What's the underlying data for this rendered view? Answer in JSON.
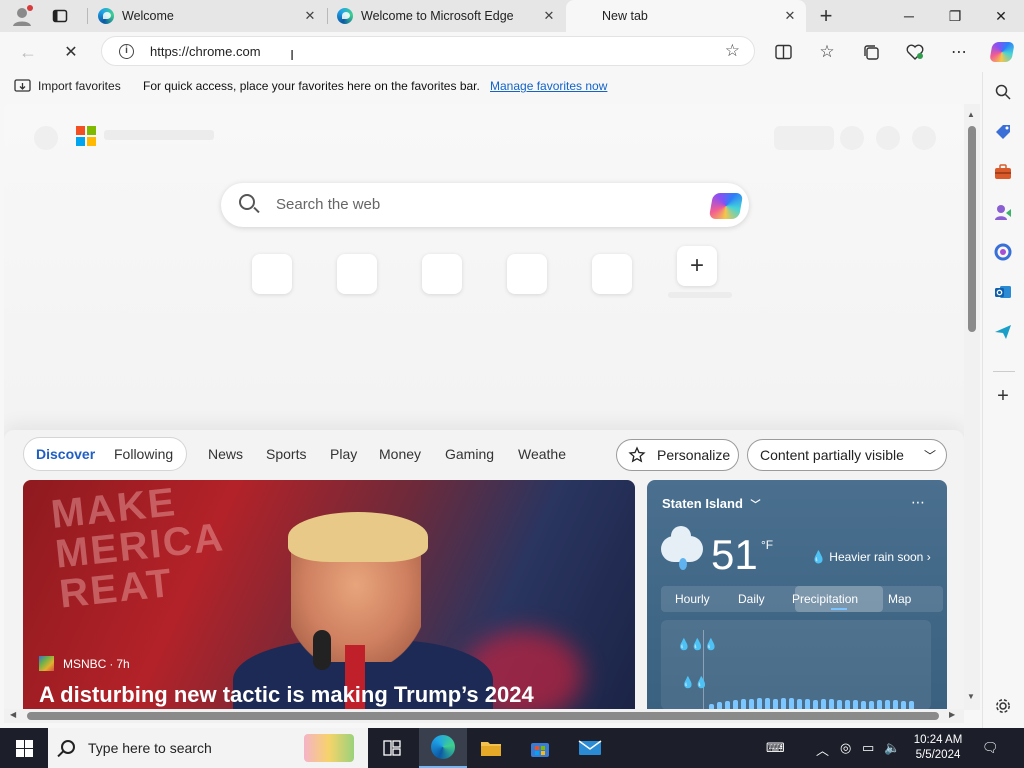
{
  "tabs": [
    {
      "title": "Welcome",
      "active": false
    },
    {
      "title": "Welcome to Microsoft Edge",
      "active": false
    },
    {
      "title": "New tab",
      "active": true
    }
  ],
  "address_bar": {
    "url": "https://chrome.com"
  },
  "favorites_bar": {
    "import_label": "Import favorites",
    "message": "For quick access, place your favorites here on the favorites bar.",
    "manage_link": "Manage favorites now"
  },
  "newtab": {
    "search_placeholder": "Search the web",
    "add_tile_label": "+"
  },
  "feed": {
    "nav": {
      "discover": "Discover",
      "following": "Following",
      "items": [
        "News",
        "Sports",
        "Play",
        "Money",
        "Gaming",
        "Weathe"
      ]
    },
    "personalize_label": "Personalize",
    "content_visibility_label": "Content partially visible",
    "top_story": {
      "source": "MSNBC",
      "age": "7h",
      "headline": "A disturbing new tactic is making Trump’s 2024"
    },
    "weather": {
      "location": "Staten Island",
      "temperature": "51",
      "unit": "°F",
      "note": "Heavier rain soon",
      "tabs": [
        "Hourly",
        "Daily",
        "Precipitation",
        "Map"
      ],
      "selected_tab": "Precipitation"
    }
  },
  "taskbar": {
    "search_placeholder": "Type here to search",
    "time": "10:24 AM",
    "date": "5/5/2024"
  },
  "colors": {
    "accent": "#1f5fc2",
    "link": "#1464c8",
    "taskbar": "#1c1f2a"
  },
  "icons": [
    "profile-icon",
    "tab-actions-icon",
    "edge-icon",
    "new-tab-icon",
    "back-icon",
    "stop-loading-icon",
    "info-icon",
    "favorite-star-icon",
    "split-screen-icon",
    "favorites-icon",
    "collections-icon",
    "browser-essentials-icon",
    "settings-more-icon",
    "copilot-icon",
    "search-icon",
    "shopping-icon",
    "tools-icon",
    "games-icon",
    "office-icon",
    "outlook-icon",
    "send-icon",
    "add-icon",
    "settings-icon"
  ]
}
